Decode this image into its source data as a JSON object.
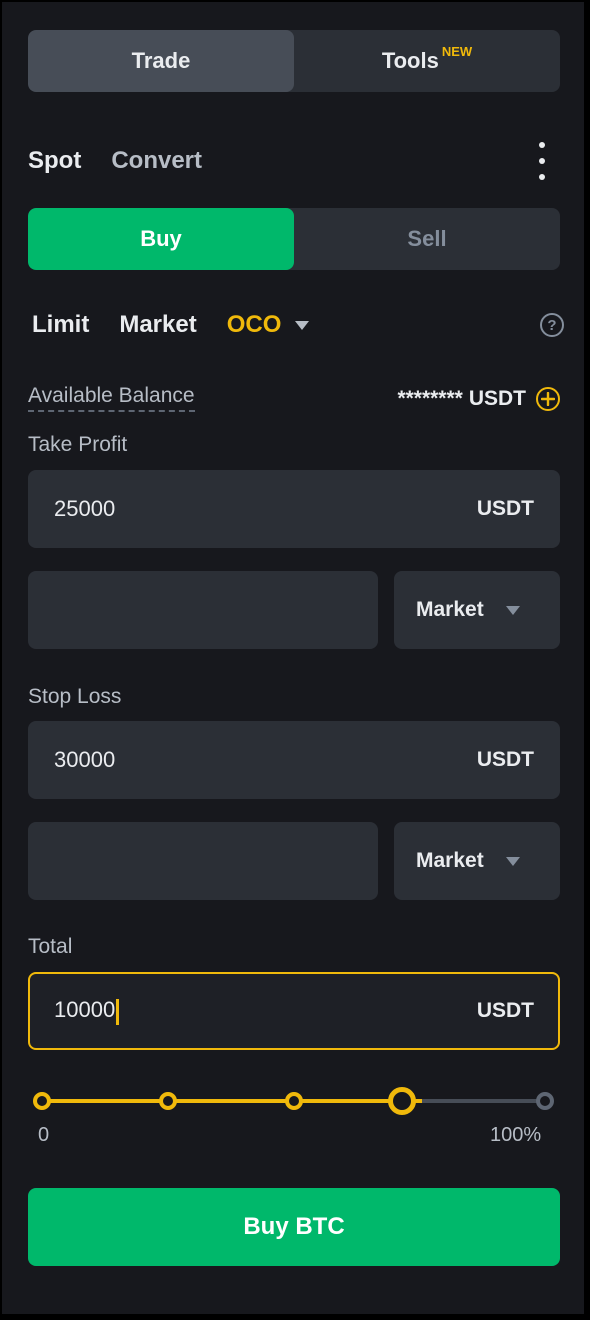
{
  "mode_tabs": {
    "trade": "Trade",
    "tools": "Tools",
    "tools_badge": "NEW"
  },
  "market_tabs": {
    "spot": "Spot",
    "convert": "Convert"
  },
  "side": {
    "buy": "Buy",
    "sell": "Sell"
  },
  "order_types": {
    "limit": "Limit",
    "market": "Market",
    "oco": "OCO",
    "help": "?"
  },
  "balance": {
    "label": "Available Balance",
    "value": "********",
    "unit": "USDT"
  },
  "take_profit": {
    "label": "Take Profit",
    "price": "25000",
    "unit": "USDT",
    "order_type": "Market"
  },
  "stop_loss": {
    "label": "Stop Loss",
    "price": "30000",
    "unit": "USDT",
    "order_type": "Market"
  },
  "total": {
    "label": "Total",
    "value": "10000",
    "unit": "USDT"
  },
  "slider": {
    "min_label": "0",
    "max_label": "100%",
    "value_percent": 75
  },
  "submit": {
    "label": "Buy BTC"
  },
  "colors": {
    "accent": "#f0b90b",
    "buy_green": "#00b86b",
    "panel": "#17181d",
    "field": "#2b2f36"
  }
}
